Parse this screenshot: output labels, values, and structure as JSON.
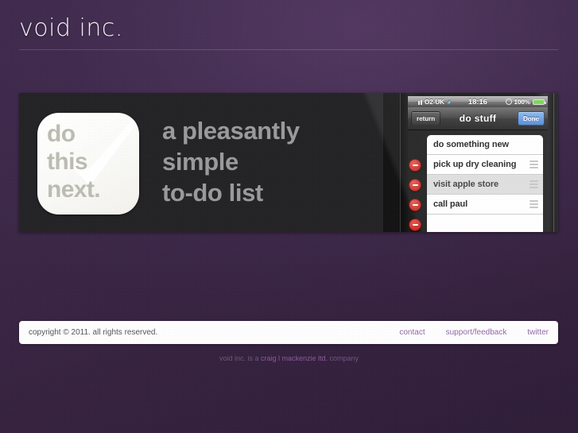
{
  "site": {
    "logo": "void inc."
  },
  "banner": {
    "app_icon": {
      "line1": "do",
      "line2": "this",
      "line3": "next.",
      "watermark_icon": "checkmark-icon"
    },
    "tagline": {
      "line1": "a pleasantly",
      "line2": "simple",
      "line3": "to-do list"
    },
    "phone": {
      "statusbar": {
        "carrier": "O2-UK",
        "time": "18:16",
        "battery": "100%",
        "signal_icon": "signal-bars-icon",
        "wifi_icon": "wifi-icon",
        "lock_icon": "rotation-lock-icon",
        "battery_icon": "battery-icon"
      },
      "navbar": {
        "back": "return",
        "title": "do stuff",
        "done": "Done"
      },
      "list": [
        {
          "label": "do something new",
          "deletable": false,
          "selected": false
        },
        {
          "label": "pick up dry cleaning",
          "deletable": true,
          "selected": false
        },
        {
          "label": "visit apple store",
          "deletable": true,
          "selected": true
        },
        {
          "label": "call paul",
          "deletable": true,
          "selected": false
        }
      ]
    }
  },
  "footer": {
    "copyright": "copyright © 2011. all rights reserved.",
    "links": [
      {
        "label": "contact"
      },
      {
        "label": "support/feedback"
      },
      {
        "label": "twitter"
      }
    ]
  },
  "byline": {
    "prefix": "void inc. is a ",
    "link": "craig l mackenzie ltd.",
    "suffix": " company"
  },
  "colors": {
    "background": "#3b2746",
    "banner": "#232325",
    "link": "#8e6aa8",
    "byline_link": "#8c5b9c",
    "delete_badge": "#b61d18",
    "done_button": "#4a83d6"
  }
}
